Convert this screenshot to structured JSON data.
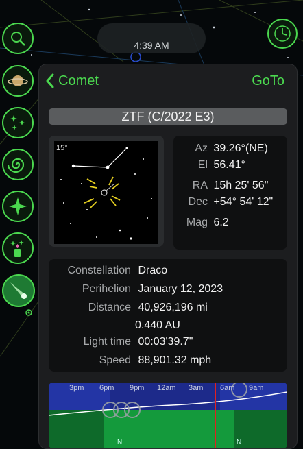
{
  "status": {
    "time": "4:39 AM"
  },
  "sidebar": {
    "buttons": [
      {
        "name": "search",
        "icon": "search-icon"
      },
      {
        "name": "solar-system",
        "icon": "planet-icon"
      },
      {
        "name": "stars",
        "icon": "stars-icon"
      },
      {
        "name": "deep-sky",
        "icon": "galaxy-icon"
      },
      {
        "name": "bright-star",
        "icon": "sparkle-icon"
      },
      {
        "name": "events",
        "icon": "candle-icon"
      },
      {
        "name": "comets",
        "icon": "comet-icon"
      }
    ],
    "clock_icon": "clock-icon"
  },
  "nav": {
    "back_label": "Comet",
    "goto_label": "GoTo"
  },
  "object": {
    "name": "ZTF (C/2022 E3)"
  },
  "finder": {
    "fov": "15°"
  },
  "position": {
    "az_label": "Az",
    "az_value": "39.26°(NE)",
    "el_label": "El",
    "el_value": "56.41°",
    "ra_label": "RA",
    "ra_value": "15h 25' 56\"",
    "dec_label": "Dec",
    "dec_value": "+54° 54' 12\"",
    "mag_label": "Mag",
    "mag_value": "6.2"
  },
  "details": {
    "constellation_label": "Constellation",
    "constellation_value": "Draco",
    "perihelion_label": "Perihelion",
    "perihelion_value": "January 12, 2023",
    "distance_label": "Distance",
    "distance_mi": "40,926,196 mi",
    "distance_au": "0.440 AU",
    "lighttime_label": "Light time",
    "lighttime_value": "00:03'39.7\"",
    "speed_label": "Speed",
    "speed_value": "88,901.32 mph"
  },
  "timeline": {
    "ticks": [
      "3pm",
      "6pm",
      "9pm",
      "12am",
      "3am",
      "6am",
      "9am"
    ],
    "north_label": "N",
    "colors": {
      "sky": "#1d2a8a",
      "ground": "#149a3c",
      "now": "#e02020"
    }
  },
  "colors": {
    "accent": "#4bd84f",
    "panel": "#1c1d1f"
  }
}
